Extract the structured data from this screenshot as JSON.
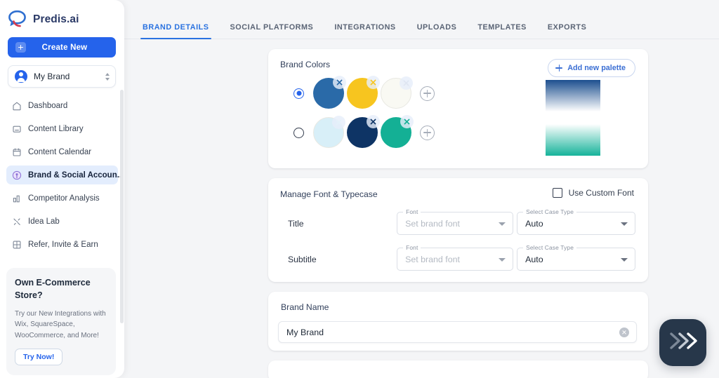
{
  "brand": {
    "logo_text": "Predis.ai",
    "logo_icon": "speech-bubble-swirl-logo"
  },
  "sidebar": {
    "create_button": {
      "label": "Create New",
      "icon": "plus-square-icon"
    },
    "brand_selector": {
      "value": "My Brand",
      "avatar_icon": "user-avatar-icon",
      "stepper_icon": "chevron-up-down-icon"
    },
    "items": [
      {
        "label": "Dashboard",
        "icon": "home-icon",
        "active": false
      },
      {
        "label": "Content Library",
        "icon": "folder-icon",
        "active": false
      },
      {
        "label": "Content Calendar",
        "icon": "calendar-icon",
        "active": false
      },
      {
        "label": "Brand & Social Accoun...",
        "icon": "broadcast-icon",
        "active": true
      },
      {
        "label": "Competitor Analysis",
        "icon": "bar-chart-icon",
        "active": false
      },
      {
        "label": "Idea Lab",
        "icon": "sparkles-icon",
        "active": false
      },
      {
        "label": "Refer, Invite & Earn",
        "icon": "gift-grid-icon",
        "active": false
      }
    ],
    "promo": {
      "title": "Own E-Commerce Store?",
      "body": "Try our New Integrations with Wix, SquareSpace, WooCommerce, and More!",
      "cta": "Try Now!"
    }
  },
  "tabs": [
    {
      "label": "BRAND DETAILS",
      "active": true
    },
    {
      "label": "SOCIAL PLATFORMS",
      "active": false
    },
    {
      "label": "INTEGRATIONS",
      "active": false
    },
    {
      "label": "UPLOADS",
      "active": false
    },
    {
      "label": "TEMPLATES",
      "active": false
    },
    {
      "label": "EXPORTS",
      "active": false
    }
  ],
  "brand_colors": {
    "title": "Brand Colors",
    "add_palette_label": "Add new palette",
    "add_palette_icon": "plus-icon",
    "palettes": [
      {
        "selected": true,
        "swatches": [
          {
            "color": "#2a6aa8",
            "remove_icon": "close-x-icon"
          },
          {
            "color": "#f7c51f",
            "remove_icon": "close-x-icon"
          },
          {
            "color": "#f9f9f3",
            "remove_icon": "close-x-icon"
          }
        ],
        "add_icon": "plus-circle-icon",
        "gradient": {
          "from": "#1c4f8f",
          "to": "#ffffff"
        }
      },
      {
        "selected": false,
        "swatches": [
          {
            "color": "#d8eff8",
            "remove_icon": "close-x-icon"
          },
          {
            "color": "#0e3465",
            "remove_icon": "close-x-icon"
          },
          {
            "color": "#14b095",
            "remove_icon": "close-x-icon"
          }
        ],
        "add_icon": "plus-circle-icon",
        "gradient": {
          "from": "#ffffff",
          "to": "#16b39a"
        }
      }
    ]
  },
  "font_section": {
    "title": "Manage Font & Typecase",
    "custom_font": {
      "label": "Use Custom Font",
      "checked": false
    },
    "rows": [
      {
        "label": "Title",
        "font": {
          "label": "Font",
          "value": "",
          "placeholder": "Set brand font"
        },
        "case": {
          "label": "Select Case Type",
          "value": "Auto"
        }
      },
      {
        "label": "Subtitle",
        "font": {
          "label": "Font",
          "value": "",
          "placeholder": "Set brand font"
        },
        "case": {
          "label": "Select Case Type",
          "value": "Auto"
        }
      }
    ]
  },
  "brand_name": {
    "title": "Brand Name",
    "value": "My Brand",
    "clear_icon": "clear-circle-icon"
  },
  "fab": {
    "icon": "triple-chevron-right-icon"
  }
}
